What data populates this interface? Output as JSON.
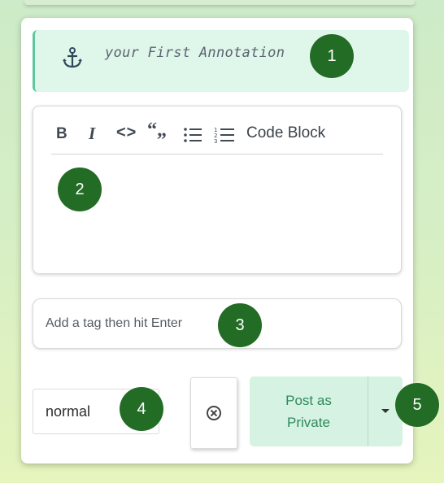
{
  "annotation": {
    "title": "your First Annotation",
    "icon": "anchor-icon"
  },
  "toolbar": {
    "bold": "B",
    "italic": "I",
    "code": "<>",
    "quote": "“„",
    "bullet_list_icon": "bullet-list-icon",
    "numbered_list_icon": "numbered-list-icon",
    "code_block": "Code Block"
  },
  "tags": {
    "placeholder": "Add a tag then hit Enter"
  },
  "privacy_select": {
    "value": "normal"
  },
  "actions": {
    "clear_icon": "clear-circle-x-icon",
    "post_label": "Post as Private",
    "dropdown_icon": "caret-down-icon"
  },
  "markers": [
    "1",
    "2",
    "3",
    "4",
    "5"
  ],
  "colors": {
    "accent_green": "#2e8a5c",
    "marker_green": "#236c26",
    "header_bg": "#dff6ea",
    "button_bg": "#d6f2e2"
  }
}
